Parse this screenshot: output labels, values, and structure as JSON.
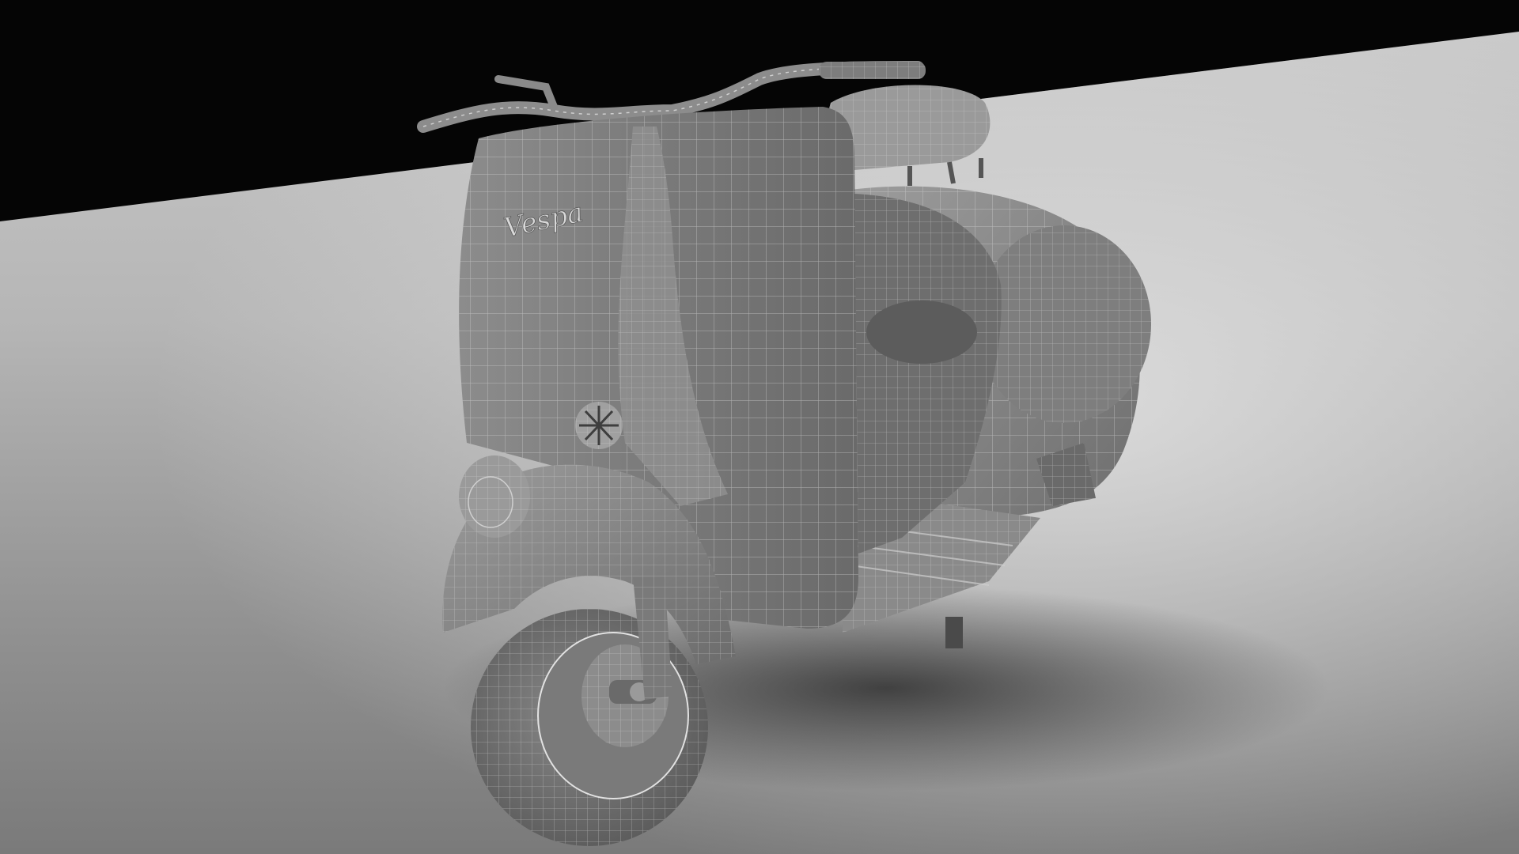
{
  "scene": {
    "subject": "wireframe-render-scooter",
    "colors": {
      "background": "#050505",
      "floor_light": "#d6d6d6",
      "floor_mid": "#9a9a9a",
      "floor_dark": "#5e5e5e",
      "body": "#7b7b7b",
      "body_light": "#9a9a9a",
      "wire": "#c8c8c8",
      "shadow": "#2f2f2f"
    }
  },
  "scooter": {
    "brand_badge": "Vespa"
  }
}
